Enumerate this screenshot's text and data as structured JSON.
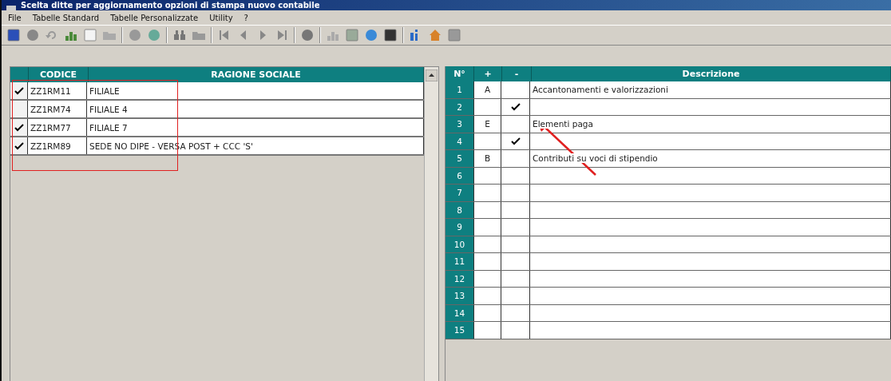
{
  "window": {
    "title": "Scelta ditte per aggiornamento opzioni di stampa nuovo contabile"
  },
  "menu": [
    "File",
    "Tabelle Standard",
    "Tabelle Personalizzate",
    "Utility",
    "?"
  ],
  "companies": {
    "columns": [
      "CODICE",
      "RAGIONE SOCIALE"
    ],
    "rows": [
      {
        "checked": true,
        "code": "ZZ1RM11",
        "name": "FILIALE"
      },
      {
        "checked": false,
        "code": "ZZ1RM74",
        "name": "FILIALE 4"
      },
      {
        "checked": true,
        "code": "ZZ1RM77",
        "name": "FILIALE 7"
      },
      {
        "checked": true,
        "code": "ZZ1RM89",
        "name": "SEDE NO DIPE - VERSA POST + CCC 'S'"
      }
    ]
  },
  "options": {
    "columns": [
      "N°",
      "+",
      "-",
      "Descrizione"
    ],
    "rows": [
      {
        "number": "1",
        "plus": "A",
        "checked": false,
        "description": "Accantonamenti e valorizzazioni"
      },
      {
        "number": "2",
        "checked": true
      },
      {
        "number": "3",
        "plus": "E",
        "checked": false,
        "description": "Elementi paga"
      },
      {
        "number": "4",
        "checked": true
      },
      {
        "number": "5",
        "plus": "B",
        "checked": false,
        "description": "Contributi su voci di stipendio"
      },
      {
        "number": "6",
        "checked": false
      },
      {
        "number": "7",
        "checked": false
      },
      {
        "number": "8",
        "checked": false
      },
      {
        "number": "9",
        "checked": false
      },
      {
        "number": "10",
        "checked": false
      },
      {
        "number": "11",
        "checked": false
      },
      {
        "number": "12",
        "checked": false
      },
      {
        "number": "13",
        "checked": false
      },
      {
        "number": "14",
        "checked": false
      },
      {
        "number": "15",
        "checked": false
      }
    ]
  }
}
